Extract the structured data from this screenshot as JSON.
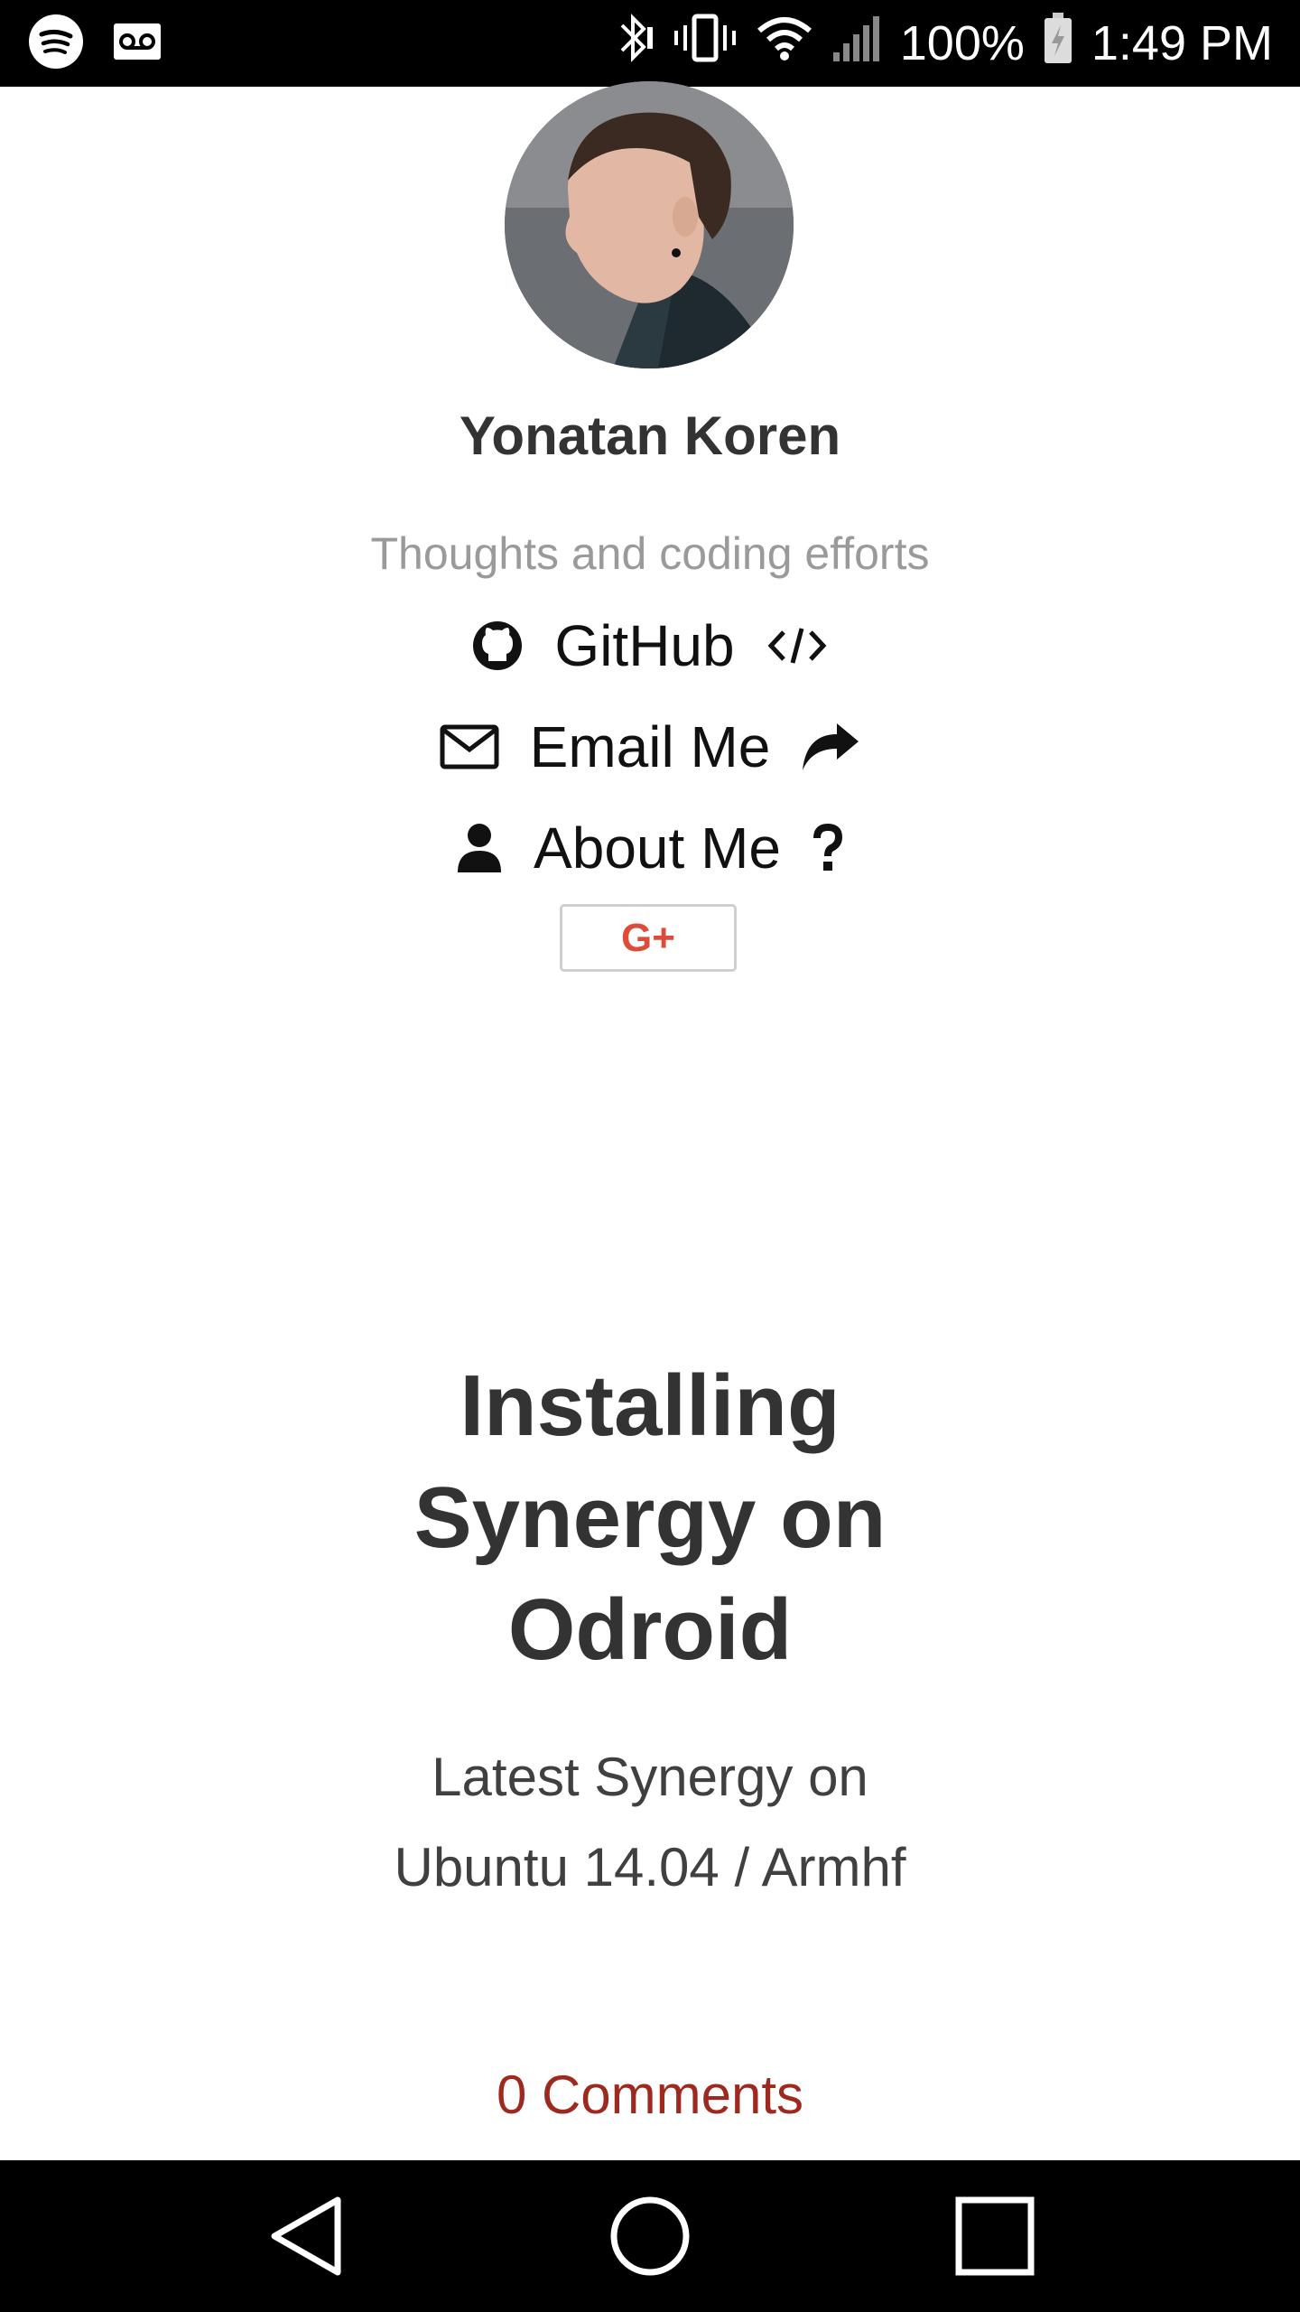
{
  "status_bar": {
    "left_icons": [
      "spotify-icon",
      "voicemail-icon"
    ],
    "right_icons": [
      "bluetooth-icon",
      "vibrate-icon",
      "wifi-icon",
      "signal-icon",
      "battery-charging-icon"
    ],
    "battery_percent": "100%",
    "time": "1:49 PM"
  },
  "profile": {
    "name": "Yonatan Koren",
    "tagline": "Thoughts and coding efforts",
    "links": [
      {
        "label": "GitHub",
        "left_icon": "github-icon",
        "right_icon": "code-icon"
      },
      {
        "label": "Email Me",
        "left_icon": "envelope-icon",
        "right_icon": "share-arrow-icon"
      },
      {
        "label": "About Me",
        "left_icon": "user-icon",
        "right_icon": "question-icon"
      }
    ],
    "gplus_label": "G+"
  },
  "post": {
    "title": "Installing Synergy on Odroid",
    "subtitle": "Latest Synergy on Ubuntu 14.04 / Armhf",
    "comments": "0 Comments"
  },
  "colors": {
    "text": "#333333",
    "tagline": "#9a9a9a",
    "comments_link": "#9e2a1f",
    "gplus": "#dd4b39",
    "bars": "#000000"
  },
  "nav_bar": {
    "buttons": [
      "back-icon",
      "home-icon",
      "recents-icon"
    ]
  }
}
